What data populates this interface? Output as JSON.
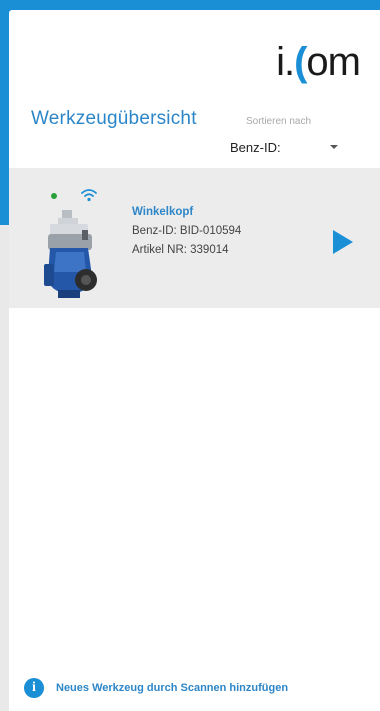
{
  "app": {
    "logo_prefix": "i.",
    "logo_arc": "(",
    "logo_suffix": "om"
  },
  "header": {
    "title": "Werkzeugübersicht",
    "sort_label": "Sortieren nach",
    "sort_value": "Benz-ID:"
  },
  "tools": [
    {
      "name": "Winkelkopf",
      "benz_id": "Benz-ID: BID-010594",
      "article_nr": "Artikel NR: 339014",
      "status": "online",
      "icon": "wifi-icon"
    }
  ],
  "footer": {
    "info_text": "Neues Werkzeug durch Scannen hinzufügen",
    "icon": "info-icon"
  },
  "colors": {
    "accent": "#1a8fd6",
    "title_blue": "#2d86c8",
    "status_green": "#2aa03a",
    "card_bg": "#ececec"
  }
}
